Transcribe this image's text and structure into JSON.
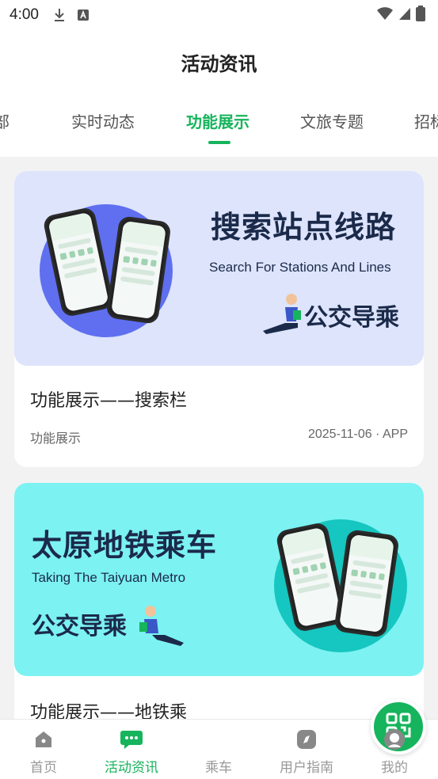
{
  "status_bar": {
    "time": "4:00"
  },
  "header": {
    "title": "活动资讯"
  },
  "tabs": [
    {
      "label": "部",
      "active": false
    },
    {
      "label": "实时动态",
      "active": false
    },
    {
      "label": "功能展示",
      "active": true
    },
    {
      "label": "文旅专题",
      "active": false
    },
    {
      "label": "招标",
      "active": false
    }
  ],
  "cards": [
    {
      "banner_heading": "搜索站点线路",
      "banner_subheading": "Search For Stations And Lines",
      "banner_tagline": "公交导乘",
      "title": "功能展示——搜索栏",
      "tag": "功能展示",
      "meta": "2025-11-06 · APP"
    },
    {
      "banner_heading": "太原地铁乘车",
      "banner_subheading": "Taking The Taiyuan Metro",
      "banner_tagline": "公交导乘",
      "title": "功能展示——地铁乘"
    }
  ],
  "bottom_nav": {
    "items": [
      {
        "label": "首页",
        "icon": "home-icon"
      },
      {
        "label": "活动资讯",
        "icon": "chat-icon",
        "active": true
      },
      {
        "label": "乘车",
        "icon": "qrcode-icon"
      },
      {
        "label": "用户指南",
        "icon": "compass-icon"
      },
      {
        "label": "我的",
        "icon": "user-icon"
      }
    ]
  },
  "colors": {
    "accent": "#16b45c",
    "banner1_bg": "#dde4fb",
    "banner2_bg": "#7cf2f2"
  }
}
